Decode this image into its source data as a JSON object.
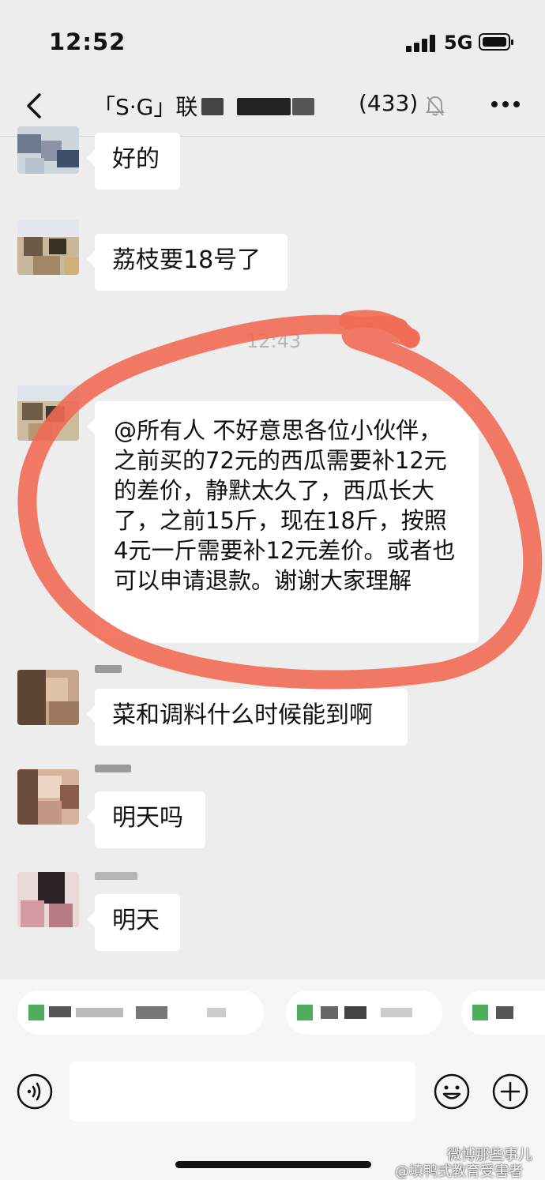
{
  "status_bar": {
    "time": "12:52",
    "network": "5G"
  },
  "nav": {
    "title": "「S·G」联",
    "member_count": "(433)"
  },
  "chat": {
    "timestamp": "12:43",
    "messages": [
      {
        "text": "好的"
      },
      {
        "text": "荔枝要18号了"
      },
      {
        "text": "@所有人 不好意思各位小伙伴，之前买的72元的西瓜需要补12元的差价，静默太久了，西瓜长大了，之前15斤，现在18斤，按照4元一斤需要补12元差价。或者也可以申请退款。谢谢大家理解"
      },
      {
        "text": "菜和调料什么时候能到啊"
      },
      {
        "text": "明天吗"
      },
      {
        "text": "明天"
      }
    ]
  },
  "watermark": {
    "line1": "微博那些事儿",
    "line2": "@填鸭式教育受害者"
  },
  "colors": {
    "background": "#ededed",
    "bubble": "#ffffff",
    "annotation": "#f06a55"
  }
}
